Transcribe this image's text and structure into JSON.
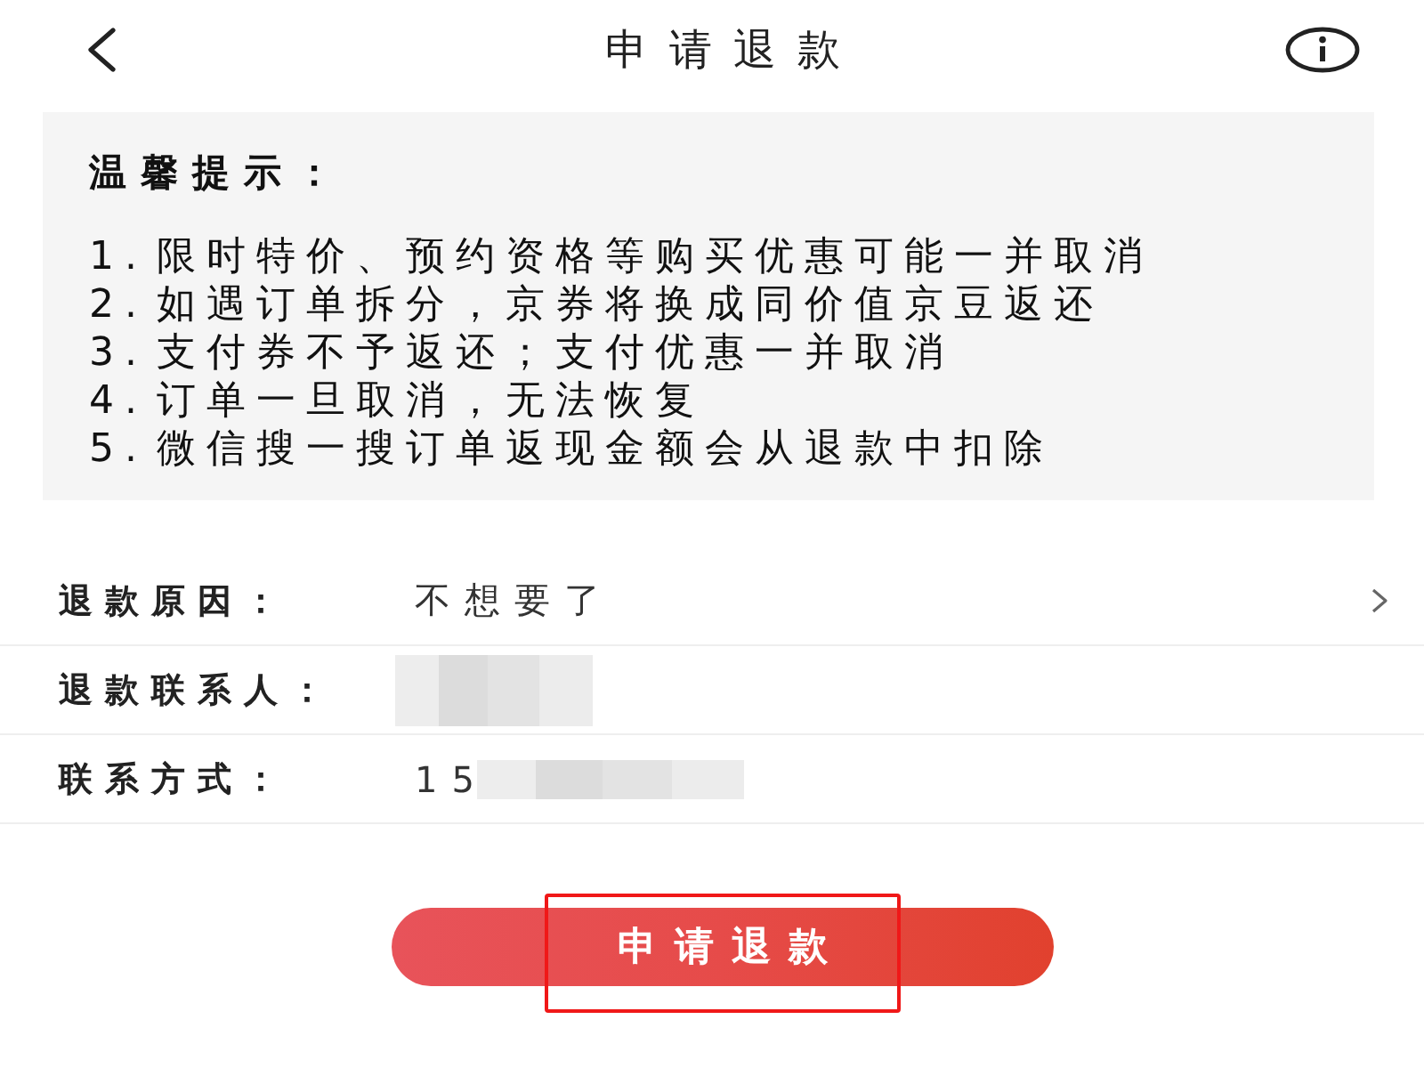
{
  "header": {
    "title": "申请退款"
  },
  "notice": {
    "title": "温馨提示：",
    "items": [
      "1. 限时特价、预约资格等购买优惠可能一并取消",
      "2. 如遇订单拆分，京券将换成同价值京豆返还",
      "3. 支付券不予返还；支付优惠一并取消",
      "4. 订单一旦取消，无法恢复",
      "5. 微信搜一搜订单返现金额会从退款中扣除"
    ]
  },
  "form": {
    "rows": [
      {
        "kind": "select",
        "label": "退款原因：",
        "value": "不想要了",
        "redacted": false
      },
      {
        "kind": "text",
        "label": "退款联系人：",
        "redacted": true
      },
      {
        "kind": "text",
        "label": "联系方式：",
        "value": "15",
        "redacted": true
      }
    ]
  },
  "submit": {
    "label": "申请退款",
    "highlighted": true
  }
}
